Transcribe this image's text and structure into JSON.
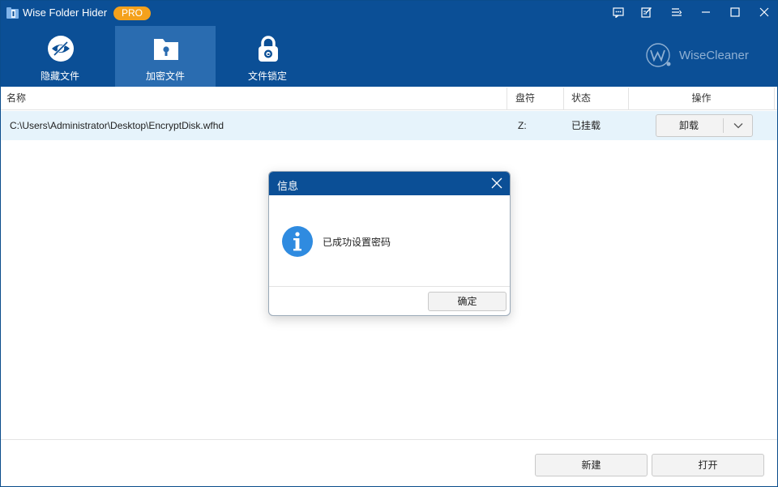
{
  "window": {
    "title": "Wise Folder Hider",
    "badge": "PRO",
    "brand": "WiseCleaner"
  },
  "titlebar_icons": [
    "feedback-icon",
    "edit-icon",
    "menu-icon",
    "minimize-icon",
    "maximize-icon",
    "close-icon"
  ],
  "tabs": [
    {
      "label": "隐藏文件",
      "icon": "hidden-eye-icon",
      "active": false
    },
    {
      "label": "加密文件",
      "icon": "encrypt-folder-icon",
      "active": true
    },
    {
      "label": "文件锁定",
      "icon": "lock-icon",
      "active": false
    }
  ],
  "table": {
    "columns": [
      "名称",
      "盘符",
      "状态",
      "操作"
    ],
    "rows": [
      {
        "name": "C:\\Users\\Administrator\\Desktop\\EncryptDisk.wfhd",
        "drive": "Z:",
        "status": "已挂载",
        "action": "卸载"
      }
    ]
  },
  "footer": {
    "new_label": "新建",
    "open_label": "打开"
  },
  "dialog": {
    "title": "信息",
    "message": "已成功设置密码",
    "ok_label": "确定",
    "icon": "info-icon"
  },
  "colors": {
    "header": "#0b4f96",
    "active_tab": "#2a6cb0",
    "pro_badge": "#f4a11c",
    "row_highlight": "#e6f3fb",
    "info_icon": "#2f8be0"
  }
}
